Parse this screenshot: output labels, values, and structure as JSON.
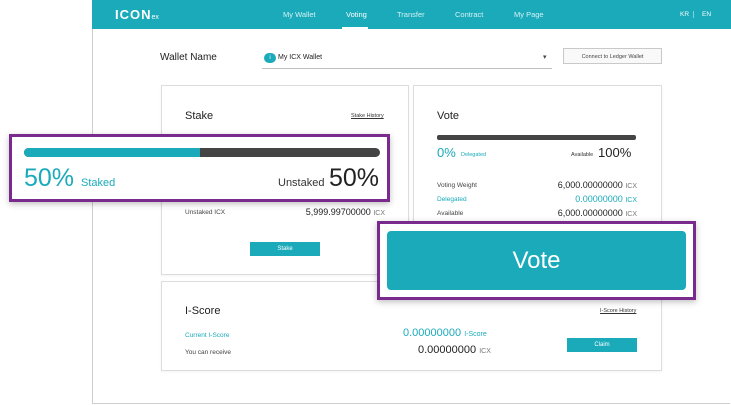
{
  "header": {
    "logo_text": "ICON",
    "logo_suffix": "ex",
    "nav": [
      "My Wallet",
      "Voting",
      "Transfer",
      "Contract",
      "My Page"
    ],
    "active_nav": "Voting",
    "languages": [
      "KR",
      "EN"
    ]
  },
  "wallet": {
    "label": "Wallet Name",
    "icon_text": "i",
    "selected": "My ICX Wallet",
    "ledger_button": "Connect to Ledger Wallet"
  },
  "stake": {
    "title": "Stake",
    "history_link": "Stake History",
    "staked_percent": "50%",
    "staked_label": "Staked",
    "unstaked_label": "Unstaked",
    "unstaked_percent": "50%",
    "staked_fraction": 0.5,
    "unstaked_row_label": "Unstaked ICX",
    "unstaked_row_value": "5,999.99700000",
    "unit": "ICX",
    "button": "Stake"
  },
  "vote": {
    "title": "Vote",
    "delegated_percent": "0%",
    "delegated_label": "Delegated",
    "available_label": "Available",
    "available_percent": "100%",
    "delegated_fraction": 0.0,
    "rows": [
      {
        "label": "Voting Weight",
        "value": "6,000.00000000",
        "unit": "ICX"
      },
      {
        "label": "Delegated",
        "value": "0.00000000",
        "unit": "ICX"
      },
      {
        "label": "Available",
        "value": "6,000.00000000",
        "unit": "ICX"
      }
    ],
    "button": "Vote"
  },
  "iscore": {
    "title": "I-Score",
    "history_link": "I-Score History",
    "current_label": "Current I-Score",
    "current_value": "0.00000000",
    "current_unit": "I-Score",
    "receive_label": "You can receive",
    "receive_value": "0.00000000",
    "receive_unit": "ICX",
    "button": "Claim"
  },
  "colors": {
    "accent": "#1aaaba",
    "highlight_border": "#7a2a8c",
    "bar_dark": "#444444"
  }
}
